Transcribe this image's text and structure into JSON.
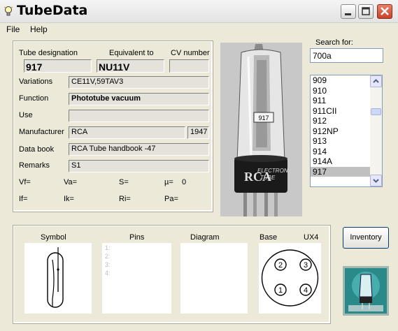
{
  "window": {
    "title": "TubeData"
  },
  "menu": [
    "File",
    "Help"
  ],
  "fields": {
    "designation_label": "Tube designation",
    "designation": "917",
    "equivalent_label": "Equivalent to",
    "equivalent": "NU11V",
    "cv_label": "CV number",
    "cv": "",
    "variations_label": "Variations",
    "variations": "CE11V,59TAV3",
    "function_label": "Function",
    "function": "Phototube vacuum",
    "use_label": "Use",
    "use": "",
    "manufacturer_label": "Manufacturer",
    "manufacturer": "RCA",
    "year": "1947",
    "databook_label": "Data book",
    "databook": "RCA Tube handbook -47",
    "remarks_label": "Remarks",
    "remarks": "S1"
  },
  "params": {
    "vf": "Vf=",
    "va": "Va=",
    "s": "S=",
    "mu": "µ=",
    "mu_value": "0",
    "if": "If=",
    "ik": "Ik=",
    "ri": "Ri=",
    "pa": "Pa="
  },
  "search": {
    "label": "Search for:",
    "value": "700a"
  },
  "list": [
    "909",
    "910",
    "911",
    "911CII",
    "912",
    "912NP",
    "913",
    "914",
    "914A",
    "917"
  ],
  "selected_index": 9,
  "bottom": {
    "symbol_label": "Symbol",
    "pins_label": "Pins",
    "diagram_label": "Diagram",
    "base_label": "Base",
    "base_type": "UX4",
    "pins": [
      "1:",
      "2:",
      "3:",
      "4:"
    ],
    "base_pins": [
      "2",
      "3",
      "1",
      "4"
    ]
  },
  "photo_labels": [
    "917",
    "RCA",
    "ELECTRON",
    "TUBE"
  ],
  "inventory_label": "Inventory"
}
